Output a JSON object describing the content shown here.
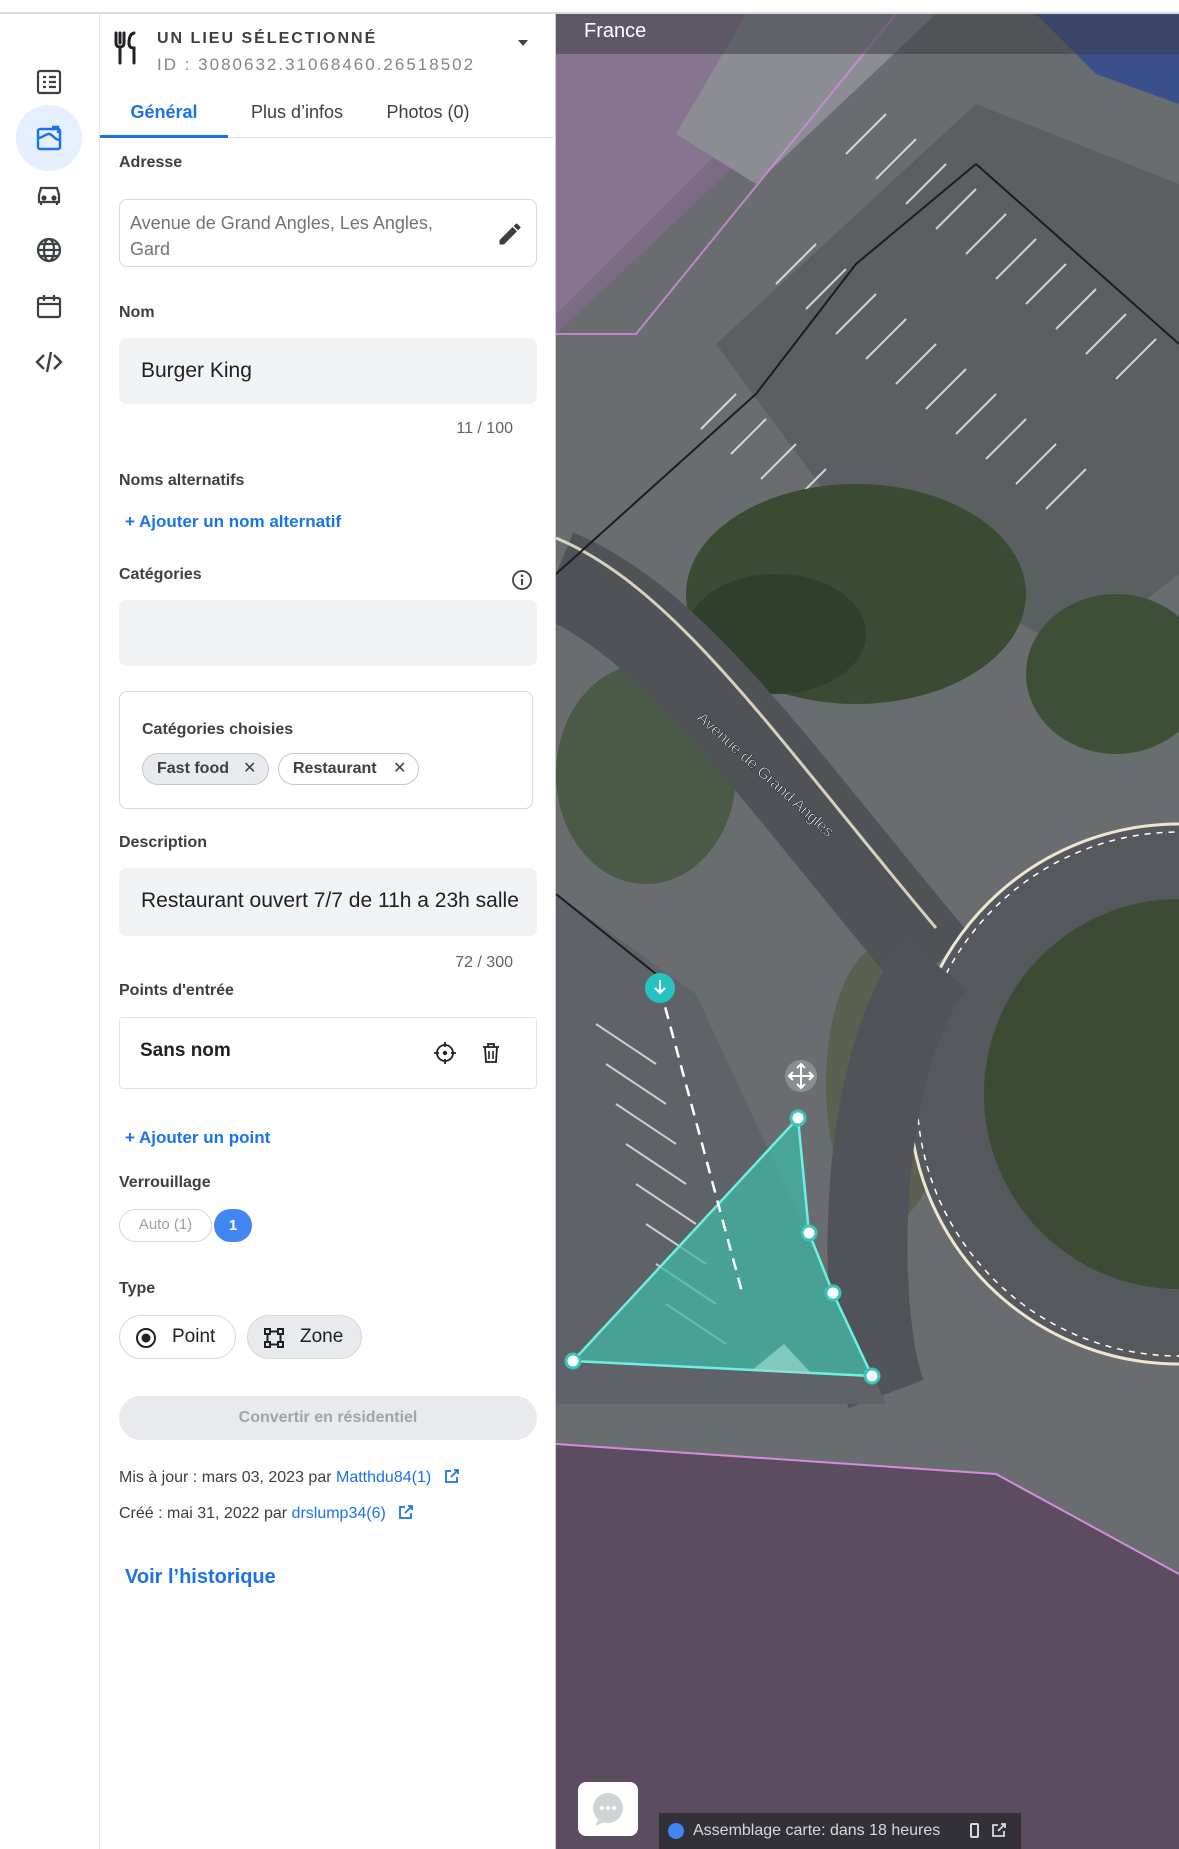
{
  "rail": {
    "items": [
      {
        "name": "list-icon"
      },
      {
        "name": "map-edit-icon",
        "active": true
      },
      {
        "name": "car-icon"
      },
      {
        "name": "globe-icon"
      },
      {
        "name": "calendar-icon"
      },
      {
        "name": "code-icon"
      }
    ]
  },
  "header": {
    "type_label": "UN LIEU SÉLECTIONNÉ",
    "id_label": "ID : 3080632.31068460.26518502",
    "icon": "fork-knife-icon"
  },
  "tabs": [
    {
      "label": "Général",
      "active": true
    },
    {
      "label": "Plus d’infos",
      "active": false
    },
    {
      "label": "Photos (0)",
      "active": false
    }
  ],
  "address": {
    "label": "Adresse",
    "value": "Avenue de Grand Angles, Les Angles, Gard"
  },
  "name": {
    "label": "Nom",
    "value": "Burger King",
    "counter": "11 / 100"
  },
  "alt_names": {
    "label": "Noms alternatifs",
    "add_link": "+ Ajouter un nom alternatif"
  },
  "categories": {
    "label": "Catégories",
    "chosen_title": "Catégories choisies",
    "chips": [
      "Fast food",
      "Restaurant"
    ]
  },
  "description": {
    "label": "Description",
    "value": "Restaurant ouvert 7/7 de 11h a 23h salle",
    "counter": "72 / 300"
  },
  "entry_points": {
    "label": "Points d'entrée",
    "items": [
      {
        "name": "Sans nom"
      }
    ],
    "add_link": "+ Ajouter un point"
  },
  "lock": {
    "label": "Verrouillage",
    "auto": "Auto (1)",
    "value": "1"
  },
  "type": {
    "label": "Type",
    "point": "Point",
    "zone": "Zone",
    "selected": "Zone"
  },
  "convert_button": "Convertir en résidentiel",
  "meta": {
    "updated_prefix": "Mis à jour : mars 03, 2023 par",
    "updated_user": "Matthdu84(1)",
    "created_prefix": "Créé : mai 31, 2022 par",
    "created_user": "drslump34(6)"
  },
  "history_link": "Voir l’historique",
  "map": {
    "country": "France",
    "street_label": "Avenue de Grand Angles",
    "status": "Assemblage carte: dans 18 heures",
    "colors": {
      "zone_fill": "#3fb7a8",
      "zone_stroke": "#6ef0e0",
      "entry_point": "#26c4c0"
    }
  }
}
